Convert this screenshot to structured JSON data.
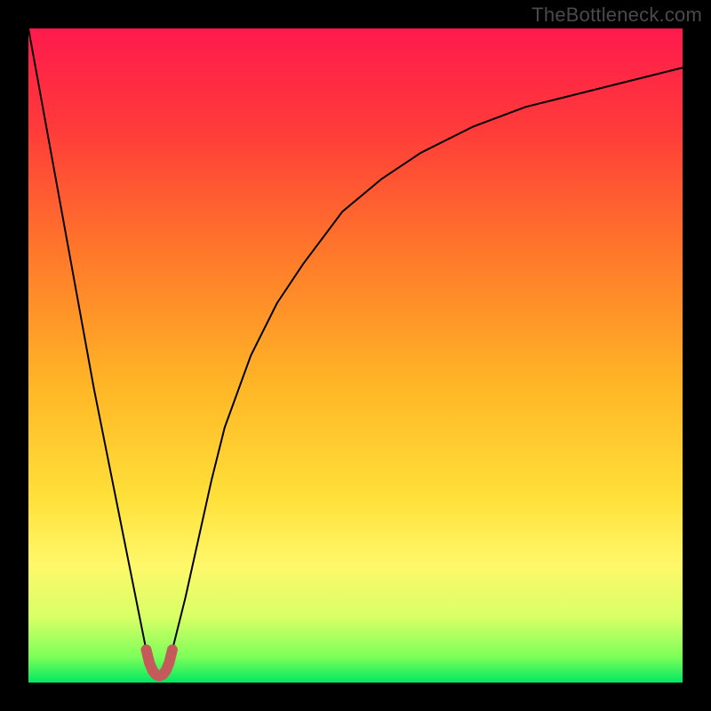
{
  "watermark": "TheBottleneck.com",
  "chart_data": {
    "type": "line",
    "title": "",
    "xlabel": "",
    "ylabel": "",
    "xlim": [
      0,
      100
    ],
    "ylim": [
      0,
      100
    ],
    "grid": false,
    "legend": false,
    "background_gradient_stops": [
      {
        "offset": 0,
        "color": "#ff1a4d"
      },
      {
        "offset": 0.15,
        "color": "#ff3a3a"
      },
      {
        "offset": 0.35,
        "color": "#ff7a2a"
      },
      {
        "offset": 0.55,
        "color": "#ffb726"
      },
      {
        "offset": 0.72,
        "color": "#ffe13a"
      },
      {
        "offset": 0.82,
        "color": "#fff86a"
      },
      {
        "offset": 0.9,
        "color": "#d8ff66"
      },
      {
        "offset": 0.96,
        "color": "#7fff5a"
      },
      {
        "offset": 1.0,
        "color": "#00e861"
      }
    ],
    "series": [
      {
        "name": "bottleneck-curve",
        "color": "#000000",
        "stroke_width": 2,
        "x": [
          0,
          2,
          4,
          6,
          8,
          10,
          12,
          14,
          16,
          17,
          18,
          19,
          20,
          21,
          22,
          24,
          26,
          28,
          30,
          34,
          38,
          42,
          48,
          54,
          60,
          68,
          76,
          84,
          92,
          100
        ],
        "values": [
          100,
          89,
          78,
          67,
          56,
          45,
          35,
          25,
          15,
          10,
          5,
          2,
          1,
          2,
          5,
          13,
          22,
          31,
          39,
          50,
          58,
          64,
          72,
          77,
          81,
          85,
          88,
          90,
          92,
          94
        ]
      }
    ],
    "marker": {
      "name": "bottleneck-dip-marker",
      "color": "#c45a5a",
      "stroke_width": 12,
      "x": [
        18.0,
        18.5,
        19.0,
        19.5,
        20.0,
        20.5,
        21.0,
        21.5,
        22.0
      ],
      "values": [
        5.0,
        3.0,
        1.8,
        1.2,
        1.0,
        1.2,
        1.8,
        3.0,
        5.0
      ]
    }
  }
}
